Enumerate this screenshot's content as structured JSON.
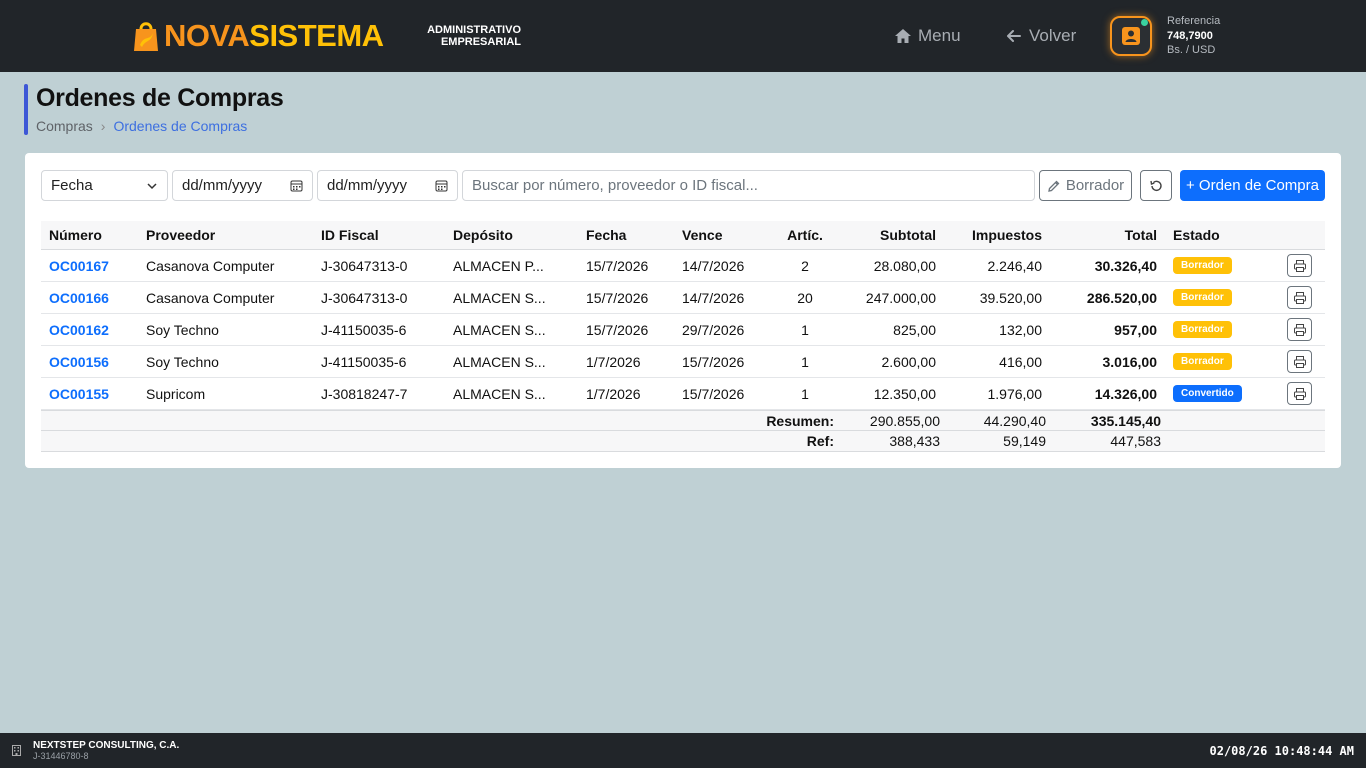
{
  "brand": {
    "name_part1": "NOVA",
    "name_part2": "SISTEMA",
    "tagline_line1": "ADMINISTRATIVO",
    "tagline_line2": "EMPRESARIAL"
  },
  "nav": {
    "menu_label": "Menu",
    "back_label": "Volver"
  },
  "reference": {
    "label": "Referencia",
    "value": "748,7900",
    "currency": "Bs. / USD"
  },
  "page": {
    "title": "Ordenes de Compras",
    "breadcrumb": [
      "Compras",
      "Ordenes de Compras"
    ]
  },
  "filters": {
    "date_field": "Fecha",
    "date_from_placeholder": "dd/mm/yyyy",
    "date_to_placeholder": "dd/mm/yyyy",
    "search_placeholder": "Buscar por número, proveedor o ID fiscal...",
    "draft_button": "Borrador",
    "new_button": "+ Orden de Compra"
  },
  "table": {
    "headers": [
      "Número",
      "Proveedor",
      "ID Fiscal",
      "Depósito",
      "Fecha",
      "Vence",
      "Artíc.",
      "Subtotal",
      "Impuestos",
      "Total",
      "Estado"
    ],
    "rows": [
      {
        "numero": "OC00167",
        "proveedor": "Casanova Computer",
        "id_fiscal": "J-30647313-0",
        "deposito": "ALMACEN P...",
        "fecha": "15/7/2026",
        "vence": "14/7/2026",
        "articulos": "2",
        "subtotal": "28.080,00",
        "impuestos": "2.246,40",
        "total": "30.326,40",
        "estado": "Borrador",
        "estado_color": "#ffc107"
      },
      {
        "numero": "OC00166",
        "proveedor": "Casanova Computer",
        "id_fiscal": "J-30647313-0",
        "deposito": "ALMACEN S...",
        "fecha": "15/7/2026",
        "vence": "14/7/2026",
        "articulos": "20",
        "subtotal": "247.000,00",
        "impuestos": "39.520,00",
        "total": "286.520,00",
        "estado": "Borrador",
        "estado_color": "#ffc107"
      },
      {
        "numero": "OC00162",
        "proveedor": "Soy Techno",
        "id_fiscal": "J-41150035-6",
        "deposito": "ALMACEN S...",
        "fecha": "15/7/2026",
        "vence": "29/7/2026",
        "articulos": "1",
        "subtotal": "825,00",
        "impuestos": "132,00",
        "total": "957,00",
        "estado": "Borrador",
        "estado_color": "#ffc107"
      },
      {
        "numero": "OC00156",
        "proveedor": "Soy Techno",
        "id_fiscal": "J-41150035-6",
        "deposito": "ALMACEN S...",
        "fecha": "1/7/2026",
        "vence": "15/7/2026",
        "articulos": "1",
        "subtotal": "2.600,00",
        "impuestos": "416,00",
        "total": "3.016,00",
        "estado": "Borrador",
        "estado_color": "#ffc107"
      },
      {
        "numero": "OC00155",
        "proveedor": "Supricom",
        "id_fiscal": "J-30818247-7",
        "deposito": "ALMACEN S...",
        "fecha": "1/7/2026",
        "vence": "15/7/2026",
        "articulos": "1",
        "subtotal": "12.350,00",
        "impuestos": "1.976,00",
        "total": "14.326,00",
        "estado": "Convertido",
        "estado_color": "#0d6efd"
      }
    ],
    "summary": {
      "label": "Resumen:",
      "subtotal": "290.855,00",
      "impuestos": "44.290,40",
      "total": "335.145,40"
    },
    "ref": {
      "label": "Ref:",
      "subtotal": "388,433",
      "impuestos": "59,149",
      "total": "447,583"
    }
  },
  "footer": {
    "company": "NEXTSTEP CONSULTING, C.A.",
    "company_id": "J-31446780-8",
    "datetime": "02/08/26 10:48:44 AM"
  },
  "colors": {
    "accent": "#0d6efd",
    "brand_orange": "#f7941d",
    "brand_yellow": "#ffc107",
    "topbar": "#212529",
    "background": "#bfd0d4"
  }
}
